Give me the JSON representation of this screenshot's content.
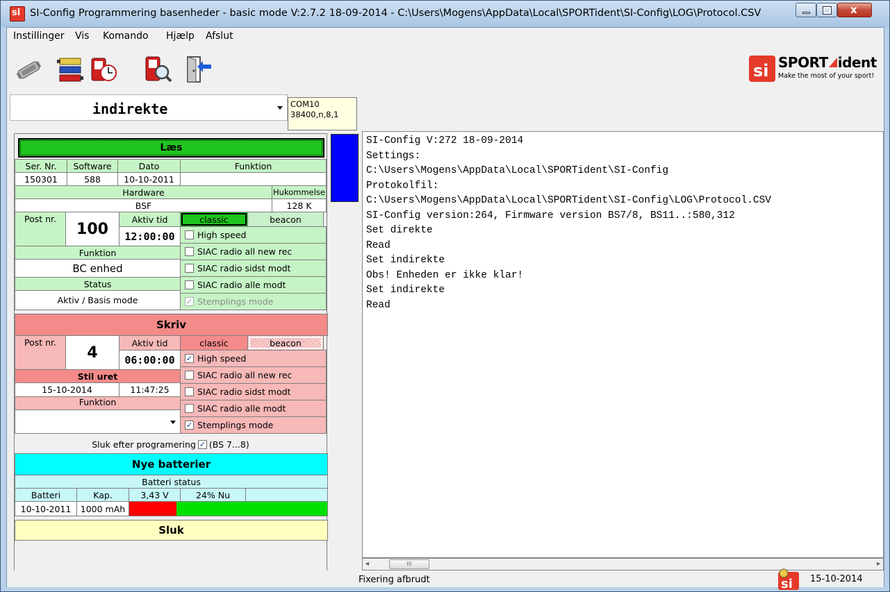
{
  "window": {
    "title": "SI-Config Programmering basenheder - basic mode V:2.7.2 18-09-2014 - C:\\Users\\Mogens\\AppData\\Local\\SPORTident\\SI-Config\\LOG\\Protocol.CSV"
  },
  "menu": [
    {
      "label": "Instillinger"
    },
    {
      "label": "Vis"
    },
    {
      "label": "Komando"
    },
    {
      "label": "Hjælp"
    },
    {
      "label": "Afslut"
    }
  ],
  "brand": {
    "name_a": "SPORT",
    "name_b": "ident",
    "tagline": "Make the most of your sport!"
  },
  "mode_select": {
    "value": "indirekte"
  },
  "com": {
    "port": "COM10",
    "settings": "38400,n,8,1"
  },
  "read": {
    "button": "Læs",
    "headers": {
      "serial": "Ser. Nr.",
      "software": "Software",
      "date": "Dato",
      "function": "Funktion"
    },
    "serial": "150301",
    "software": "588",
    "date": "10-10-2011",
    "function": "",
    "hardware_label": "Hardware",
    "memory_label": "Hukommelse",
    "hardware": "BSF",
    "memory": "128 K",
    "post_label": "Post nr.",
    "post": "100",
    "active_label": "Aktiv tid",
    "active_time": "12:00:00",
    "function_label": "Funktion",
    "function_value": "BC enhed",
    "status_label": "Status",
    "status_value": "Aktiv / Basis mode",
    "mode_classic": "classic",
    "mode_beacon": "beacon",
    "options": [
      {
        "label": "High speed",
        "checked": false
      },
      {
        "label": "SIAC radio all new rec",
        "checked": false
      },
      {
        "label": "SIAC radio sidst modt",
        "checked": false
      },
      {
        "label": "SIAC radio alle modt",
        "checked": false
      },
      {
        "label": "Stemplings mode",
        "checked": true,
        "disabled": true
      }
    ]
  },
  "write": {
    "button": "Skriv",
    "post_label": "Post nr.",
    "post": "4",
    "active_label": "Aktiv tid",
    "active_time": "06:00:00",
    "mode_classic": "classic",
    "mode_beacon": "beacon",
    "set_clock": "Stil uret",
    "date": "15-10-2014",
    "time": "11:47:25",
    "function_label": "Funktion",
    "function_value": "",
    "options": [
      {
        "label": "High speed",
        "checked": true
      },
      {
        "label": "SIAC radio all new rec",
        "checked": false
      },
      {
        "label": "SIAC radio sidst modt",
        "checked": false
      },
      {
        "label": "SIAC radio alle modt",
        "checked": false
      },
      {
        "label": "Stemplings mode",
        "checked": true
      }
    ],
    "turn_off_label": "Sluk efter programering",
    "turn_off_note": "(BS 7...8)"
  },
  "battery": {
    "button": "Nye batterier",
    "status_label": "Batteri status",
    "voltage": "3,43 V",
    "percent_text": "24% Nu",
    "percent_value": 24,
    "battery_label": "Batteri",
    "capacity_label": "Kap.",
    "date": "10-10-2011",
    "capacity": "1000 mAh"
  },
  "off_button": "Sluk",
  "log_lines": [
    "SI-Config V:272 18-09-2014",
    "Settings:",
    "C:\\Users\\Mogens\\AppData\\Local\\SPORTident\\SI-Config",
    "Protokolfil:",
    "C:\\Users\\Mogens\\AppData\\Local\\SPORTident\\SI-Config\\LOG\\Protocol.CSV",
    "SI-Config version:264, Firmware version BS7/8, BS11..:580,312",
    "Set direkte",
    "Read",
    "Set indirekte",
    "Obs! Enheden er ikke klar!",
    "Set indirekte",
    "Read"
  ],
  "status": {
    "message": "Fixering afbrudt",
    "date": "15-10-2014"
  },
  "colors": {
    "read_green": "#c6f4c6",
    "write_pink": "#f7b8b8",
    "write_header": "#f48a8a",
    "battery_cyan": "#00ffff",
    "battery_red": "#ff0000",
    "battery_green": "#00e000"
  }
}
